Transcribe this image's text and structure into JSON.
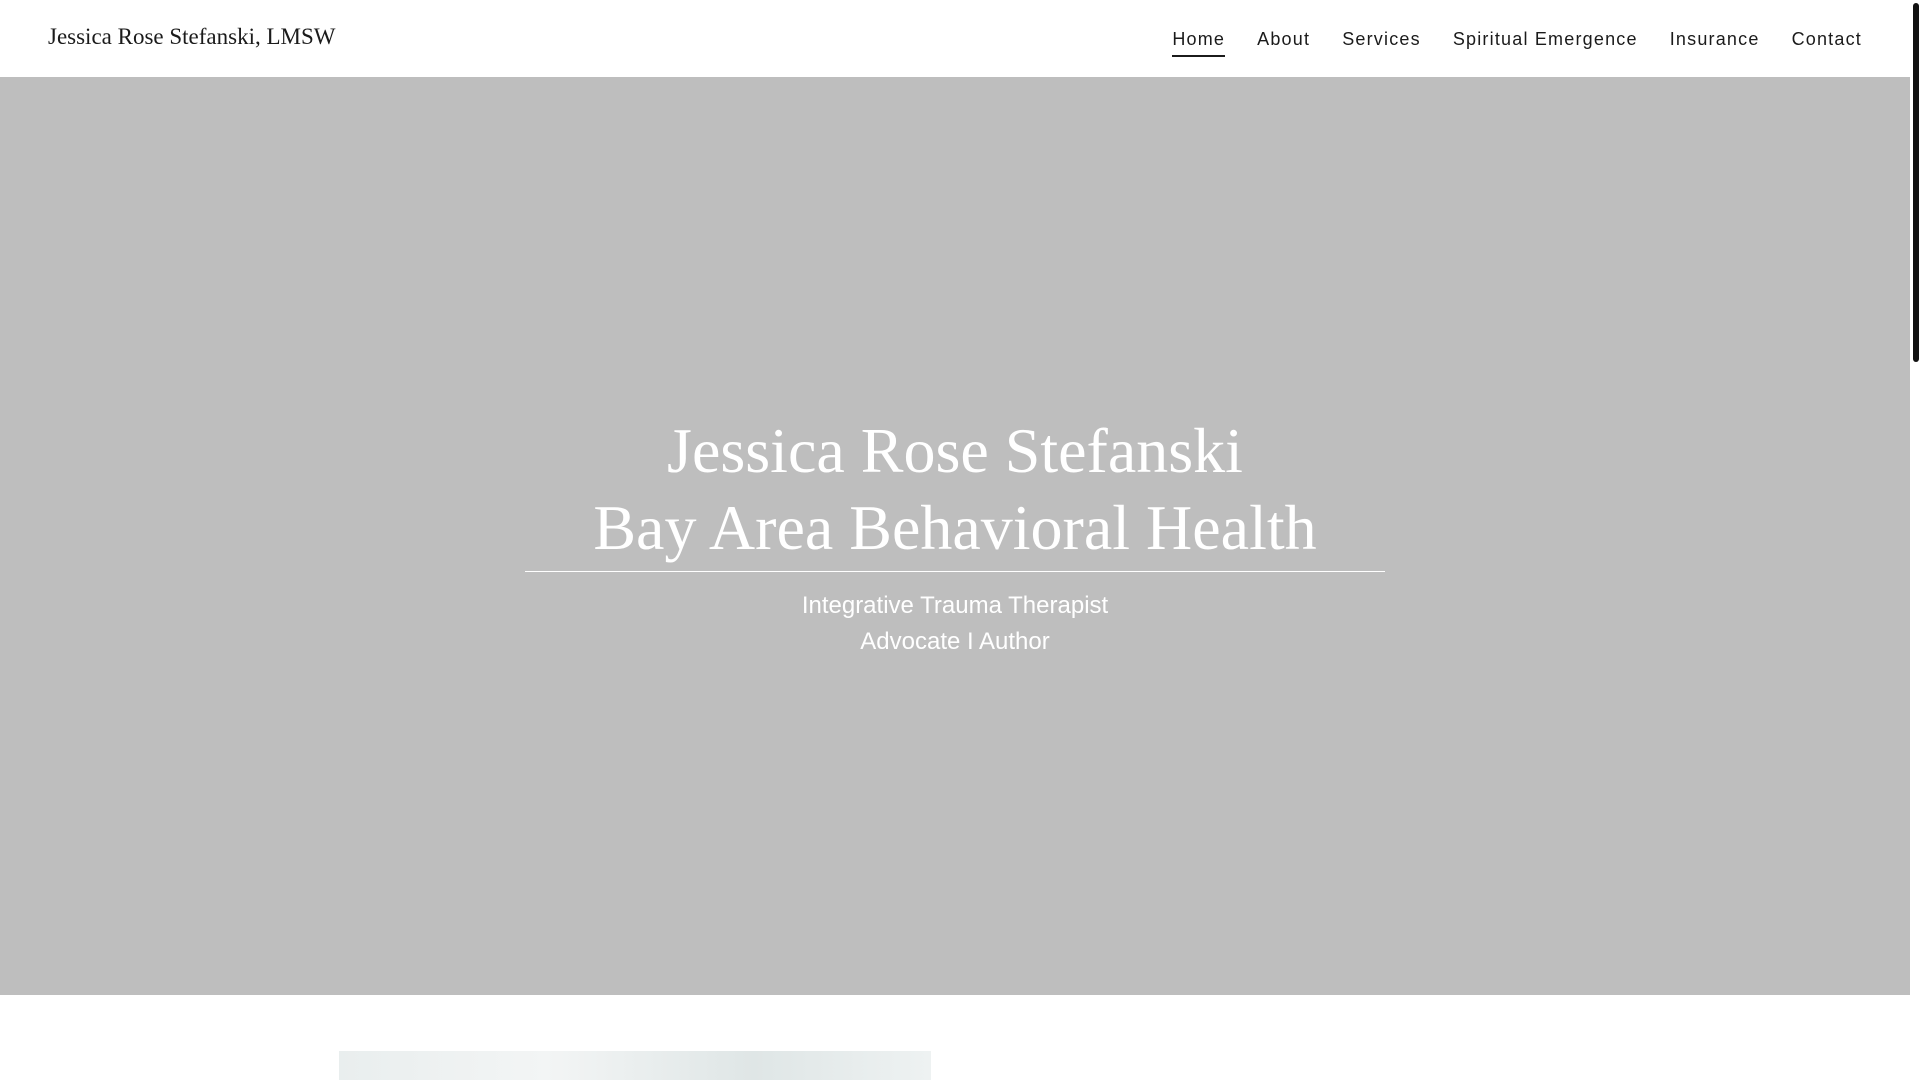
{
  "header": {
    "brand": "Jessica Rose Stefanski, LMSW",
    "nav": [
      {
        "label": "Home",
        "active": true
      },
      {
        "label": "About"
      },
      {
        "label": "Services"
      },
      {
        "label": "Spiritual Emergence"
      },
      {
        "label": "Insurance"
      },
      {
        "label": "Contact"
      }
    ]
  },
  "hero": {
    "title_line1": "Jessica Rose Stefanski",
    "title_line2": "Bay Area Behavioral Health",
    "subtitle_line1": "Integrative Trauma Therapist",
    "subtitle_line2": "Advocate I Author",
    "background_color": "#bebebe",
    "text_color": "#ffffff"
  }
}
